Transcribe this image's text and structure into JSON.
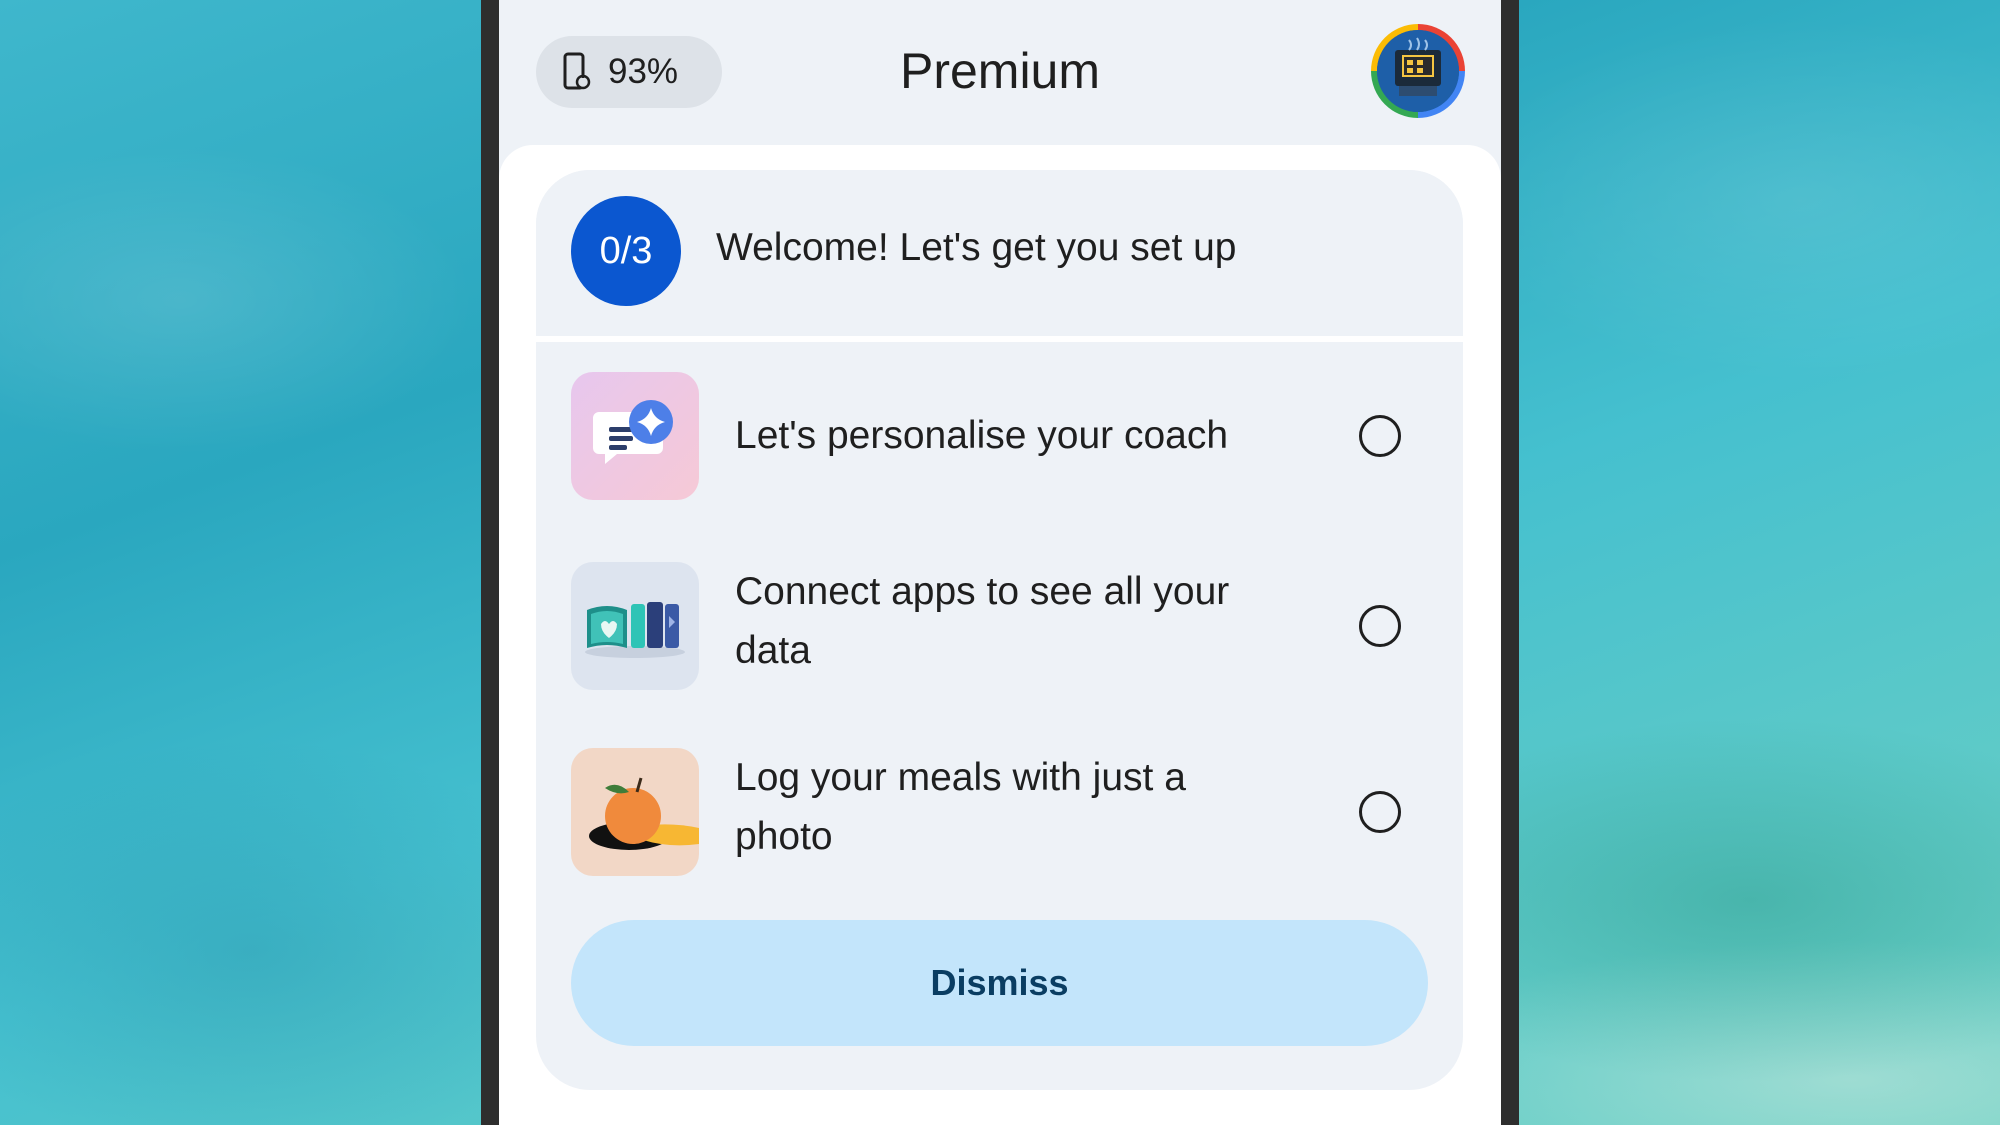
{
  "status": {
    "battery_percent": "93%",
    "battery_icon": "phone-battery-icon"
  },
  "header": {
    "title": "Premium",
    "avatar_icon": "profile-avatar"
  },
  "setup_card": {
    "progress": "0/3",
    "heading": "Welcome! Let's get you set up",
    "tasks": [
      {
        "label": "Let's personalise your coach",
        "icon": "coach-chat-sparkle-icon",
        "done": false
      },
      {
        "label": "Connect apps to see all your data",
        "icon": "connected-apps-icon",
        "done": false
      },
      {
        "label": "Log your meals with just a photo",
        "icon": "meal-photo-orange-icon",
        "done": false
      }
    ],
    "dismiss_label": "Dismiss"
  },
  "colors": {
    "accent": "#0b57d0",
    "button_bg": "#c3e5fb",
    "card_bg": "#eef2f7"
  }
}
